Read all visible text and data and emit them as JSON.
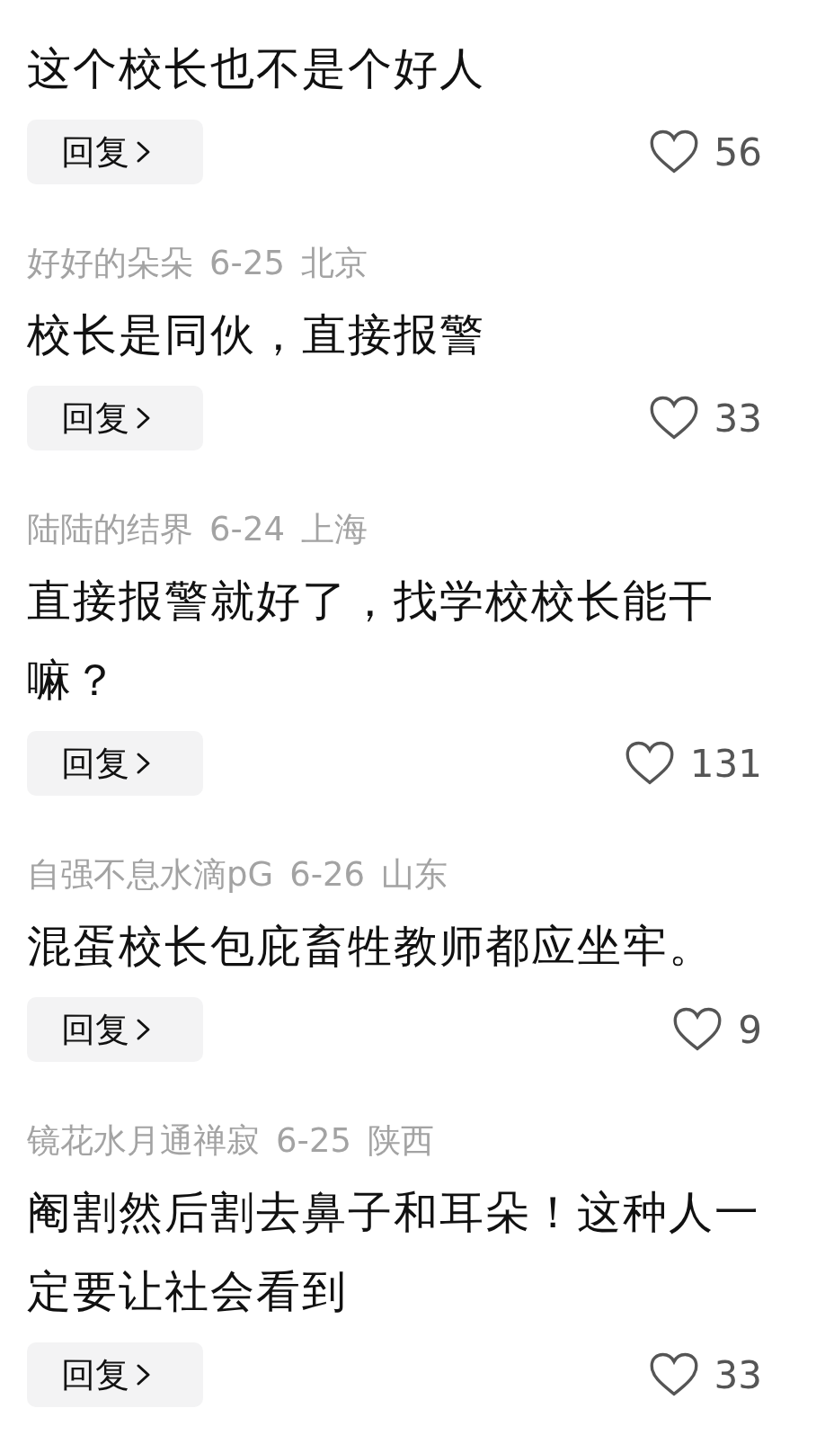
{
  "comments": [
    {
      "body": "这个校长也不是个好人",
      "reply": "回复",
      "likes": "56",
      "liked": false
    },
    {
      "user": "好好的朵朵",
      "date": "6-25",
      "region": "北京",
      "body": "校长是同伙，直接报警",
      "reply": "回复",
      "likes": "33",
      "liked": false
    },
    {
      "user": "陆陆的结界",
      "date": "6-24",
      "region": "上海",
      "body": "直接报警就好了，找学校校长能干嘛？",
      "reply": "回复",
      "likes": "131",
      "liked": false
    },
    {
      "user": "自强不息水滴pG",
      "date": "6-26",
      "region": "山东",
      "body": "混蛋校长包庇畜牲教师都应坐牢。",
      "reply": "回复",
      "likes": "9",
      "liked": false
    },
    {
      "user": "镜花水月通禅寂",
      "date": "6-25",
      "region": "陕西",
      "body": "阉割然后割去鼻子和耳朵！这种人一定要让社会看到",
      "reply": "回复",
      "likes": "33",
      "liked": false
    }
  ]
}
